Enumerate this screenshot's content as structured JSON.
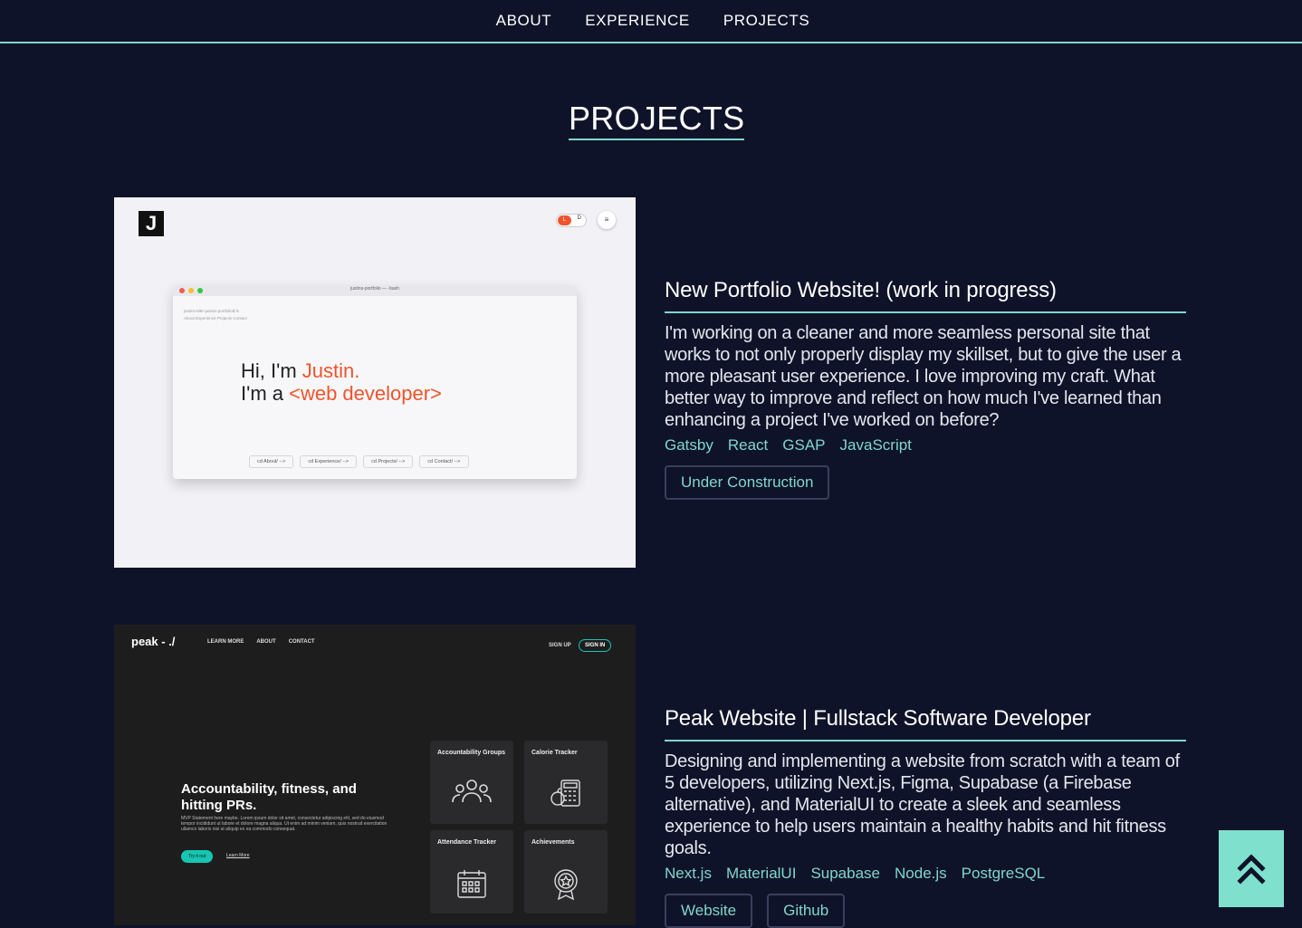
{
  "nav": {
    "items": [
      "ABOUT",
      "EXPERIENCE",
      "PROJECTS"
    ]
  },
  "section_title": "PROJECTS",
  "projects": [
    {
      "title": "New Portfolio Website! (work in progress)",
      "description": "I'm working on a cleaner and more seamless personal site that works to not only properly display my skillset, but to give the user a more pleasant user experience. I love improving my craft. What better way to improve and reflect on how much I've learned than enhancing a project I've worked on before?",
      "tags": [
        "Gatsby",
        "React",
        "GSAP",
        "JavaScript"
      ],
      "buttons": [
        "Under Construction"
      ],
      "screenshot": {
        "logo": "J",
        "toggle_left": "L",
        "toggle_right": "D",
        "menu": "≡",
        "terminal_title": "justins-portfolio    — -bash",
        "terminal_prompt": "justins-MB~justins-portfolio$ ls",
        "terminal_dirs": "About  Experience  Projects  Contact",
        "greeting_prefix": "Hi, I'm ",
        "greeting_name": "Justin.",
        "role_prefix": "I'm a ",
        "role": "<web developer>",
        "links": [
          "cd About/  -->",
          "cd Experience/  -->",
          "cd Projects/  -->",
          "cd Contact/  -->"
        ]
      }
    },
    {
      "title": "Peak Website | Fullstack Software Developer",
      "description": "Designing and implementing a website from scratch with a team of 5 developers, utilizing Next.js, Figma, Supabase (a Firebase alternative), and MaterialUI to create a sleek and seamless experience to help users maintain a healthy habits and hit fitness goals.",
      "tags": [
        "Next.js",
        "MaterialUI",
        "Supabase",
        "Node.js",
        "PostgreSQL"
      ],
      "buttons": [
        "Website",
        "Github"
      ],
      "screenshot": {
        "brand": "peak - ./",
        "nav": [
          "LEARN MORE",
          "ABOUT",
          "CONTACT"
        ],
        "sign_up": "SIGN UP",
        "sign_in": "SIGN IN",
        "hero_heading": "Accountability, fitness, and hitting PRs.",
        "hero_text": "MVP Statement here maybe. Lorem ipsum dolor sit amet, consectetur adipiscing elit, sed do eiusmod tempor incididunt ut labore et dolore magna aliqua. Ut enim ad minim veniam, quis nostrud exercitation ullamco laboris nisi ut aliquip ex ea commodo consequat.",
        "try_button": "Try it out",
        "learn_link": "Learn More",
        "tiles": [
          "Accountability Groups",
          "Calorie Tracker",
          "Attendance Tracker",
          "Achievements"
        ]
      }
    }
  ],
  "colors": {
    "background": "#0f1329",
    "accent": "#7fd6cf",
    "orange": "#f0532b",
    "teal": "#16c6b2"
  },
  "icons": {
    "back_to_top": "double-chevron-up-icon"
  }
}
